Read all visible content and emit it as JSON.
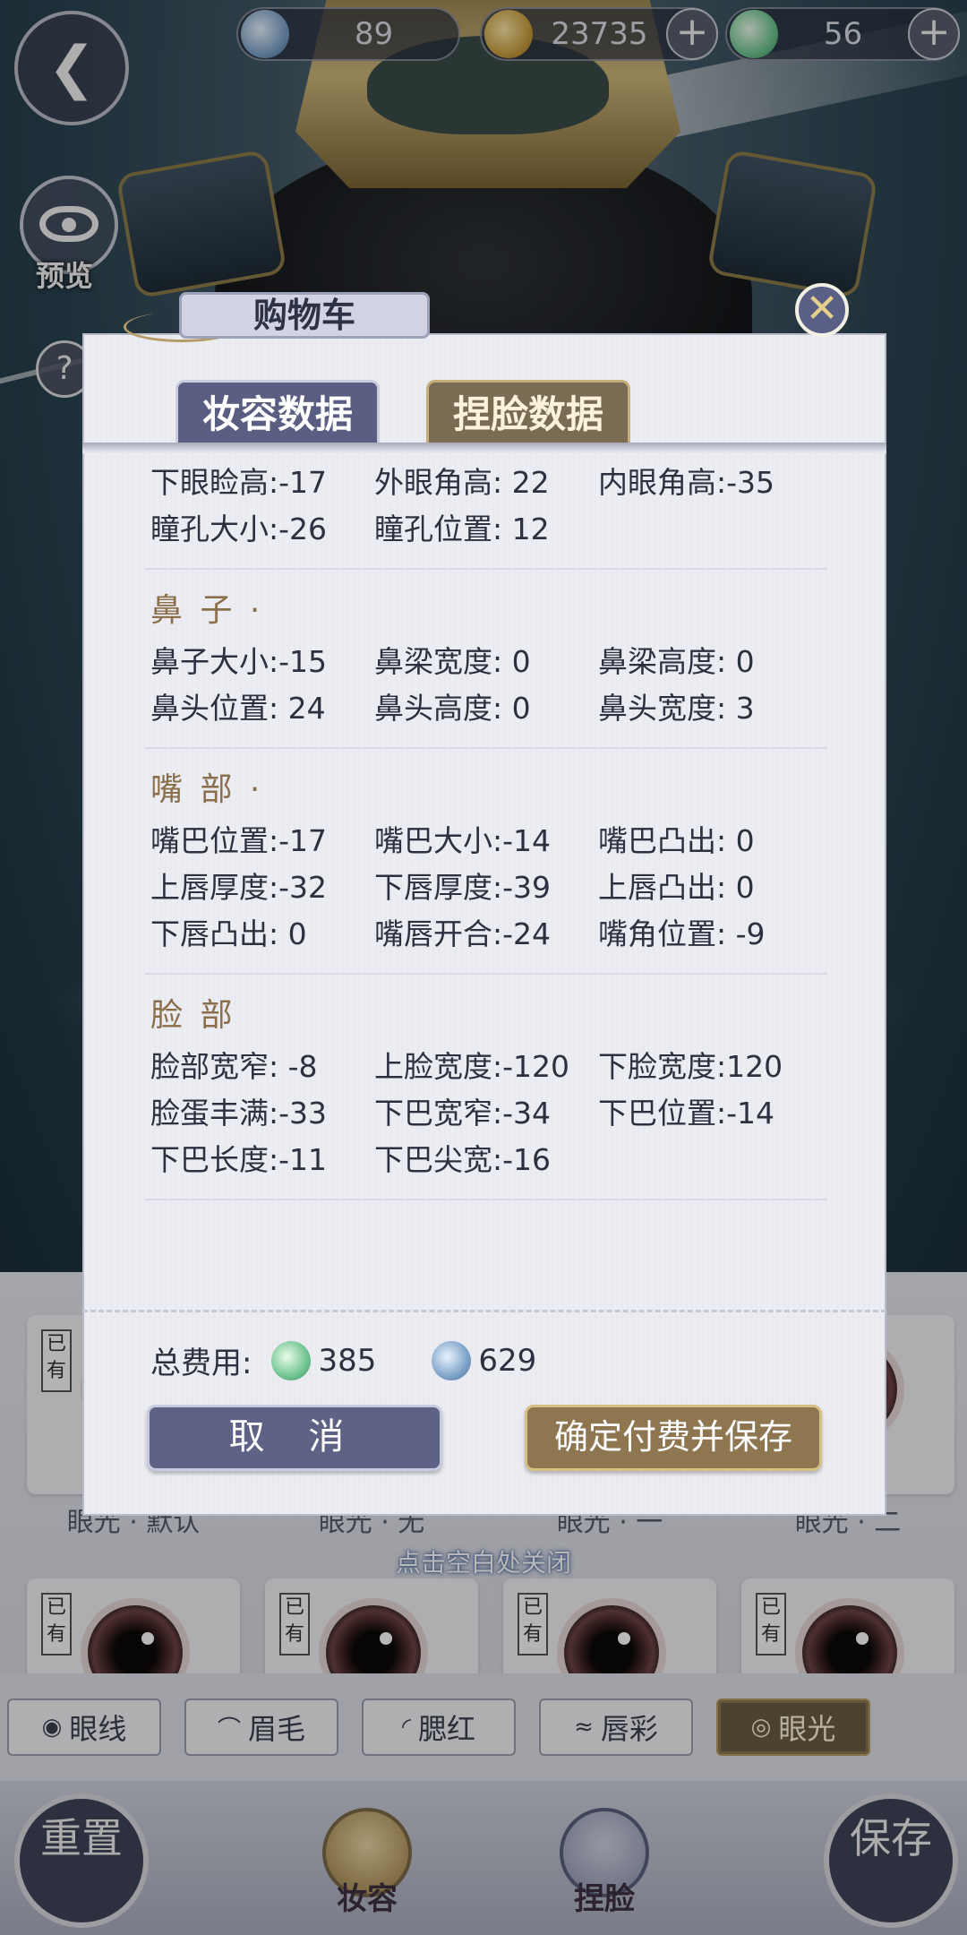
{
  "currencies": [
    {
      "icon": "silver-coin-icon",
      "value": "89"
    },
    {
      "icon": "gold-coin-icon",
      "value": "23735"
    },
    {
      "icon": "jade-coin-icon",
      "value": "56"
    }
  ],
  "side": {
    "preview_label": "预览",
    "help_label": "?"
  },
  "modal": {
    "title": "购物车",
    "tabs": [
      {
        "label": "妆容数据"
      },
      {
        "label": "捏脸数据"
      }
    ],
    "eyes_partial": {
      "rows": [
        [
          "下眼睑高:-17",
          "外眼角高: 22",
          "内眼角高:-35"
        ],
        [
          "瞳孔大小:-26",
          "瞳孔位置: 12",
          ""
        ]
      ]
    },
    "nose": {
      "title": "鼻 子 ·",
      "rows": [
        [
          "鼻子大小:-15",
          "鼻梁宽度: 0",
          "鼻梁高度: 0"
        ],
        [
          "鼻头位置: 24",
          "鼻头高度: 0",
          "鼻头宽度: 3"
        ]
      ]
    },
    "mouth": {
      "title": "嘴 部 ·",
      "rows": [
        [
          "嘴巴位置:-17",
          "嘴巴大小:-14",
          "嘴巴凸出: 0"
        ],
        [
          "上唇厚度:-32",
          "下唇厚度:-39",
          "上唇凸出: 0"
        ],
        [
          "下唇凸出: 0",
          "嘴唇开合:-24",
          "嘴角位置: -9"
        ]
      ]
    },
    "face": {
      "title": "脸 部",
      "rows": [
        [
          "脸部宽窄: -8",
          "上脸宽度:-120",
          "下脸宽度:120"
        ],
        [
          "脸蛋丰满:-33",
          "下巴宽窄:-34",
          "下巴位置:-14"
        ],
        [
          "下巴长度:-11",
          "下巴尖宽:-16",
          ""
        ]
      ]
    },
    "total_label": "总费用:",
    "total_jade": "385",
    "total_silver": "629",
    "cancel_label": "取 消",
    "confirm_label": "确定付费并保存"
  },
  "hint": "点击空白处关闭",
  "eye_cards_row1": [
    {
      "owned": "已有",
      "name": "眼光 · 默认"
    },
    {
      "owned": "",
      "name": "眼光 · 无"
    },
    {
      "owned": "",
      "name": "眼光 · 一"
    },
    {
      "owned": "",
      "name": "眼光 · 二"
    }
  ],
  "eye_cards_row2": [
    {
      "owned": "已有"
    },
    {
      "owned": "已有"
    },
    {
      "owned": "已有"
    },
    {
      "owned": "已有"
    }
  ],
  "categories": [
    {
      "icon": "eye-icon",
      "label": "眼线"
    },
    {
      "icon": "brow-icon",
      "label": "眉毛"
    },
    {
      "icon": "blush-icon",
      "label": "腮红"
    },
    {
      "icon": "lips-icon",
      "label": "唇彩"
    },
    {
      "icon": "eye-glint-icon",
      "label": "眼光"
    }
  ],
  "nav": {
    "reset_label": "重置",
    "makeup_label": "妆容",
    "face_label": "捏脸",
    "save_label": "保存"
  }
}
